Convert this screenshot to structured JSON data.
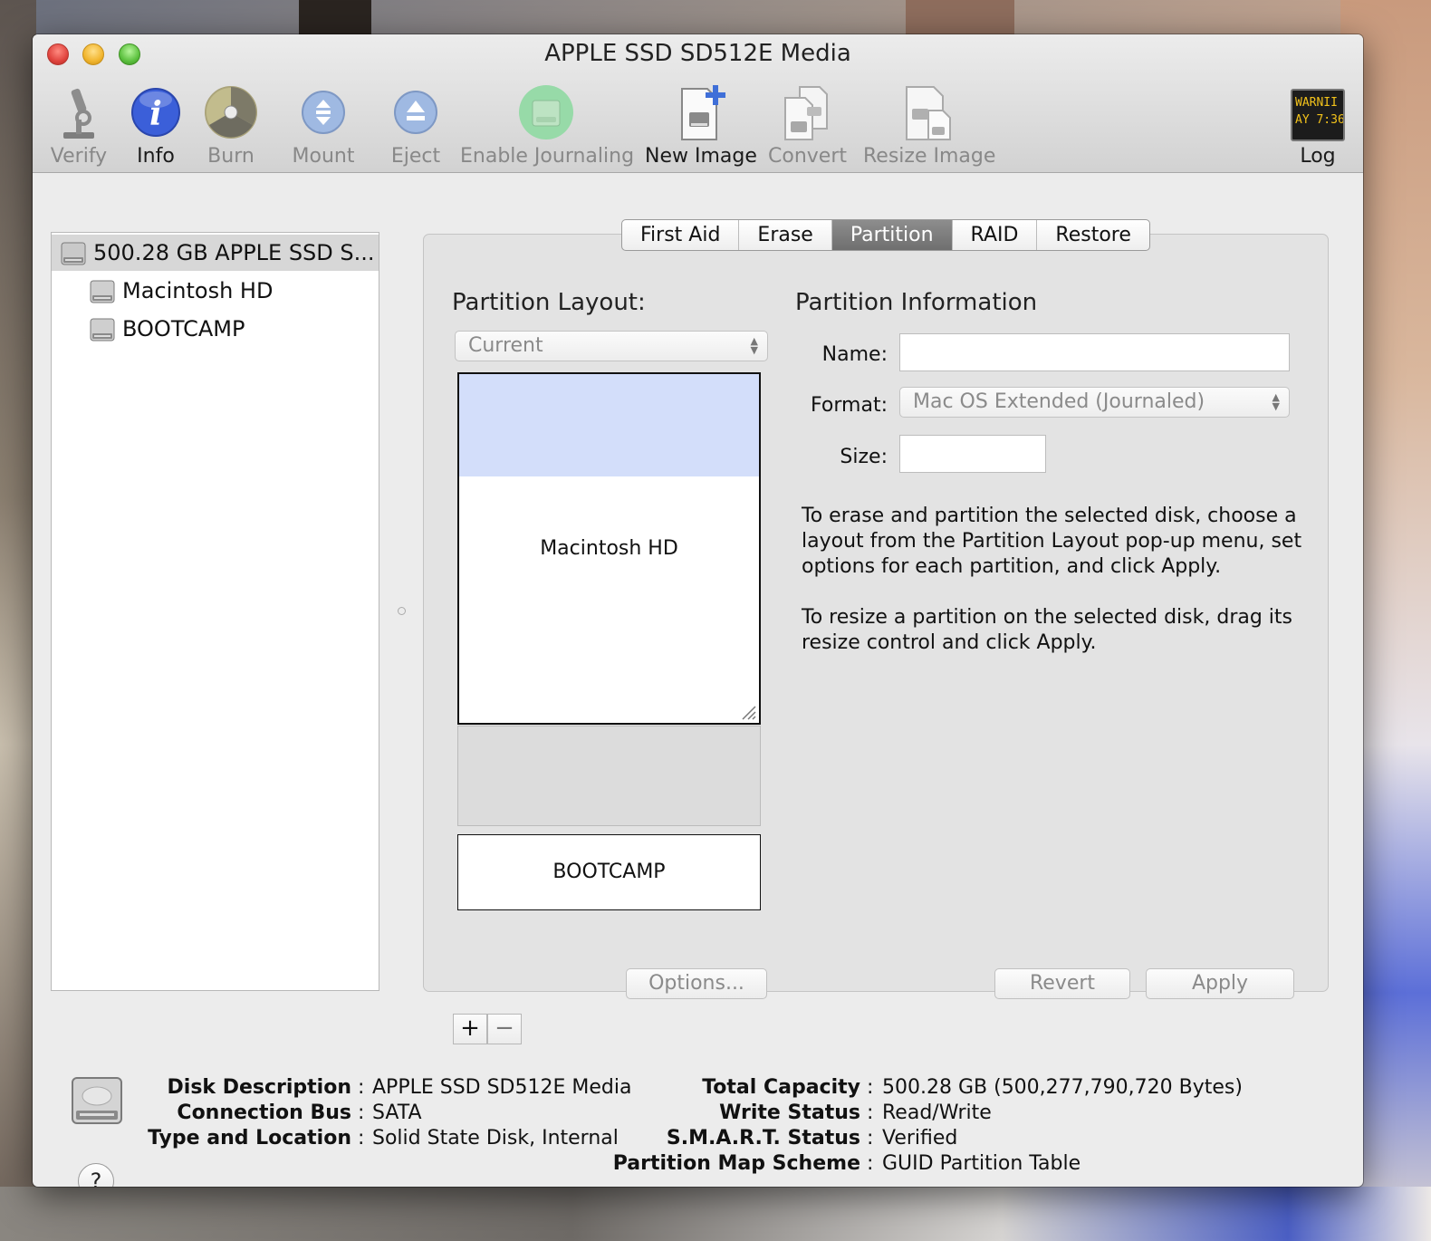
{
  "window": {
    "title": "APPLE SSD SD512E Media"
  },
  "toolbar": {
    "verify": "Verify",
    "info": "Info",
    "burn": "Burn",
    "mount": "Mount",
    "eject": "Eject",
    "enable_journaling": "Enable Journaling",
    "new_image": "New Image",
    "convert": "Convert",
    "resize_image": "Resize Image",
    "log": "Log",
    "log_icon_line1": "WARNII",
    "log_icon_line2": "AY 7:36"
  },
  "sidebar": {
    "items": [
      {
        "label": "500.28 GB APPLE SSD S...",
        "selected": true,
        "icon": "internal-disk-icon"
      },
      {
        "label": "Macintosh HD",
        "selected": false,
        "icon": "volume-icon"
      },
      {
        "label": "BOOTCAMP",
        "selected": false,
        "icon": "volume-icon"
      }
    ]
  },
  "tabs": [
    "First Aid",
    "Erase",
    "Partition",
    "RAID",
    "Restore"
  ],
  "active_tab": "Partition",
  "partition": {
    "layout_title": "Partition Layout:",
    "layout_popup": "Current",
    "info_title": "Partition Information",
    "name_label": "Name:",
    "name_value": "",
    "format_label": "Format:",
    "format_value": "Mac OS Extended (Journaled)",
    "size_label": "Size:",
    "size_value": "",
    "partitions": [
      {
        "name": "Macintosh HD"
      },
      {
        "name": "BOOTCAMP"
      }
    ],
    "help_text_1": "To erase and partition the selected disk, choose a layout from the Partition Layout pop-up menu, set options for each partition, and click Apply.",
    "help_text_2": "To resize a partition on the selected disk, drag its resize control and click Apply.",
    "add_button": "+",
    "remove_button": "−",
    "options_button": "Options...",
    "revert_button": "Revert",
    "apply_button": "Apply"
  },
  "disk_info": {
    "left": [
      {
        "label": "Disk Description",
        "value": "APPLE SSD SD512E Media"
      },
      {
        "label": "Connection Bus",
        "value": "SATA"
      },
      {
        "label": "Type and Location",
        "value": "Solid State Disk, Internal"
      }
    ],
    "right": [
      {
        "label": "Total Capacity",
        "value": "500.28 GB (500,277,790,720 Bytes)"
      },
      {
        "label": "Write Status",
        "value": "Read/Write"
      },
      {
        "label": "S.M.A.R.T. Status",
        "value": "Verified"
      },
      {
        "label": "Partition Map Scheme",
        "value": "GUID Partition Table"
      }
    ],
    "separator": ":",
    "help_button": "?"
  },
  "colors": {
    "selected_partition": "#d3defa",
    "free_space": "#dcdcdc",
    "info_icon": "#3b5fd9",
    "tab_active": "#7a7a7a"
  }
}
